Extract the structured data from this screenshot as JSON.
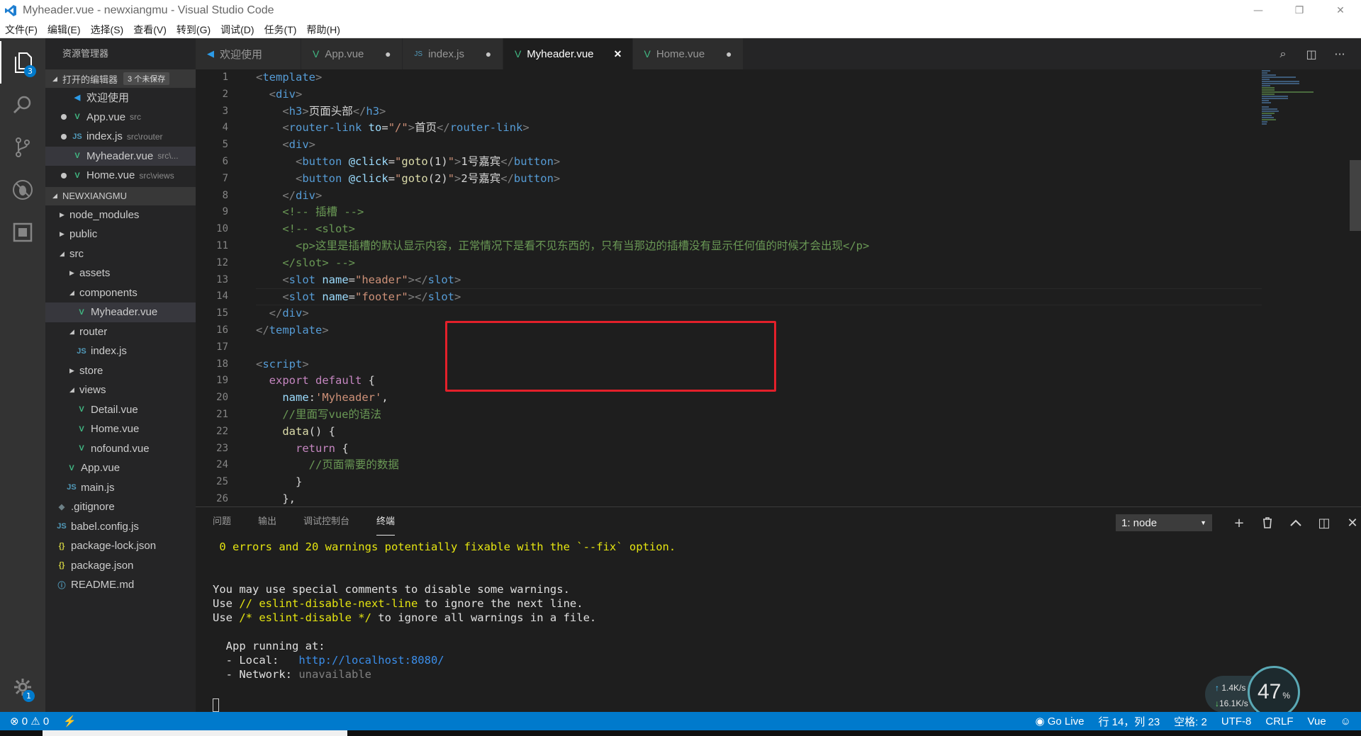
{
  "window": {
    "title": "Myheader.vue - newxiangmu - Visual Studio Code",
    "controls": {
      "minimize": "—",
      "restore": "❐",
      "close": "✕"
    }
  },
  "menu": [
    "文件(F)",
    "编辑(E)",
    "选择(S)",
    "查看(V)",
    "转到(G)",
    "调试(D)",
    "任务(T)",
    "帮助(H)"
  ],
  "activity": {
    "explorer_badge": "3",
    "settings_badge": "1"
  },
  "sidebar": {
    "header": "资源管理器",
    "open_editors": {
      "label": "打开的编辑器",
      "unsaved": "3 个未保存",
      "items": [
        {
          "name": "欢迎使用",
          "desc": "",
          "icon": "vs",
          "dirty": false
        },
        {
          "name": "App.vue",
          "desc": "src",
          "icon": "vue",
          "dirty": true
        },
        {
          "name": "index.js",
          "desc": "src\\router",
          "icon": "js",
          "dirty": true
        },
        {
          "name": "Myheader.vue",
          "desc": "src\\...",
          "icon": "vue",
          "dirty": false
        },
        {
          "name": "Home.vue",
          "desc": "src\\views",
          "icon": "vue",
          "dirty": true
        }
      ]
    },
    "project": {
      "label": "NEWXIANGMU",
      "tree": [
        {
          "name": "node_modules",
          "type": "folder",
          "open": false,
          "depth": 0
        },
        {
          "name": "public",
          "type": "folder",
          "open": false,
          "depth": 0
        },
        {
          "name": "src",
          "type": "folder",
          "open": true,
          "depth": 0
        },
        {
          "name": "assets",
          "type": "folder",
          "open": false,
          "depth": 1
        },
        {
          "name": "components",
          "type": "folder",
          "open": true,
          "depth": 1
        },
        {
          "name": "Myheader.vue",
          "type": "vue",
          "depth": 2,
          "selected": true
        },
        {
          "name": "router",
          "type": "folder",
          "open": true,
          "depth": 1
        },
        {
          "name": "index.js",
          "type": "js",
          "depth": 2
        },
        {
          "name": "store",
          "type": "folder",
          "open": false,
          "depth": 1
        },
        {
          "name": "views",
          "type": "folder",
          "open": true,
          "depth": 1
        },
        {
          "name": "Detail.vue",
          "type": "vue",
          "depth": 2
        },
        {
          "name": "Home.vue",
          "type": "vue",
          "depth": 2
        },
        {
          "name": "nofound.vue",
          "type": "vue",
          "depth": 2
        },
        {
          "name": "App.vue",
          "type": "vue",
          "depth": 1
        },
        {
          "name": "main.js",
          "type": "js",
          "depth": 1
        },
        {
          "name": ".gitignore",
          "type": "git",
          "depth": 0
        },
        {
          "name": "babel.config.js",
          "type": "js",
          "depth": 0
        },
        {
          "name": "package-lock.json",
          "type": "json",
          "depth": 0
        },
        {
          "name": "package.json",
          "type": "json",
          "depth": 0
        },
        {
          "name": "README.md",
          "type": "info",
          "depth": 0
        }
      ]
    }
  },
  "tabs": [
    {
      "label": "欢迎使用",
      "icon": "vs",
      "mark": "",
      "active": false
    },
    {
      "label": "App.vue",
      "icon": "vue",
      "mark": "●",
      "active": false
    },
    {
      "label": "index.js",
      "icon": "js",
      "mark": "●",
      "active": false
    },
    {
      "label": "Myheader.vue",
      "icon": "vue",
      "mark": "✕",
      "active": true
    },
    {
      "label": "Home.vue",
      "icon": "vue",
      "mark": "●",
      "active": false
    }
  ],
  "editor": {
    "line_numbers": [
      "1",
      "2",
      "3",
      "4",
      "5",
      "6",
      "7",
      "8",
      "9",
      "10",
      "11",
      "12",
      "13",
      "14",
      "15",
      "16",
      "17",
      "18",
      "19",
      "20",
      "21",
      "22",
      "23",
      "24",
      "25",
      "26"
    ],
    "lines": [
      [
        [
          "t-brk",
          "<"
        ],
        [
          "t-tag",
          "template"
        ],
        [
          "t-brk",
          ">"
        ]
      ],
      [
        [
          "t-txt",
          "  "
        ],
        [
          "t-brk",
          "<"
        ],
        [
          "t-tag",
          "div"
        ],
        [
          "t-brk",
          ">"
        ]
      ],
      [
        [
          "t-txt",
          "    "
        ],
        [
          "t-brk",
          "<"
        ],
        [
          "t-tag",
          "h3"
        ],
        [
          "t-brk",
          ">"
        ],
        [
          "t-txt",
          "页面头部"
        ],
        [
          "t-brk",
          "</"
        ],
        [
          "t-tag",
          "h3"
        ],
        [
          "t-brk",
          ">"
        ]
      ],
      [
        [
          "t-txt",
          "    "
        ],
        [
          "t-brk",
          "<"
        ],
        [
          "t-tag",
          "router-link"
        ],
        [
          "t-txt",
          " "
        ],
        [
          "t-attr",
          "to"
        ],
        [
          "t-txt",
          "="
        ],
        [
          "t-str",
          "\"/\""
        ],
        [
          "t-brk",
          ">"
        ],
        [
          "t-txt",
          "首页"
        ],
        [
          "t-brk",
          "</"
        ],
        [
          "t-tag",
          "router-link"
        ],
        [
          "t-brk",
          ">"
        ]
      ],
      [
        [
          "t-txt",
          "    "
        ],
        [
          "t-brk",
          "<"
        ],
        [
          "t-tag",
          "div"
        ],
        [
          "t-brk",
          ">"
        ]
      ],
      [
        [
          "t-txt",
          "      "
        ],
        [
          "t-brk",
          "<"
        ],
        [
          "t-tag",
          "button"
        ],
        [
          "t-txt",
          " "
        ],
        [
          "t-attr",
          "@click"
        ],
        [
          "t-txt",
          "="
        ],
        [
          "t-str",
          "\""
        ],
        [
          "t-fn",
          "goto"
        ],
        [
          "t-txt",
          "(1)"
        ],
        [
          "t-str",
          "\""
        ],
        [
          "t-brk",
          ">"
        ],
        [
          "t-txt",
          "1号嘉宾"
        ],
        [
          "t-brk",
          "</"
        ],
        [
          "t-tag",
          "button"
        ],
        [
          "t-brk",
          ">"
        ]
      ],
      [
        [
          "t-txt",
          "      "
        ],
        [
          "t-brk",
          "<"
        ],
        [
          "t-tag",
          "button"
        ],
        [
          "t-txt",
          " "
        ],
        [
          "t-attr",
          "@click"
        ],
        [
          "t-txt",
          "="
        ],
        [
          "t-str",
          "\""
        ],
        [
          "t-fn",
          "goto"
        ],
        [
          "t-txt",
          "(2)"
        ],
        [
          "t-str",
          "\""
        ],
        [
          "t-brk",
          ">"
        ],
        [
          "t-txt",
          "2号嘉宾"
        ],
        [
          "t-brk",
          "</"
        ],
        [
          "t-tag",
          "button"
        ],
        [
          "t-brk",
          ">"
        ]
      ],
      [
        [
          "t-txt",
          "    "
        ],
        [
          "t-brk",
          "</"
        ],
        [
          "t-tag",
          "div"
        ],
        [
          "t-brk",
          ">"
        ]
      ],
      [
        [
          "t-txt",
          "    "
        ],
        [
          "t-cmt",
          "<!-- 插槽 -->"
        ]
      ],
      [
        [
          "t-txt",
          "    "
        ],
        [
          "t-cmt",
          "<!-- <slot>"
        ]
      ],
      [
        [
          "t-txt",
          "      "
        ],
        [
          "t-cmt",
          "<p>这里是插槽的默认显示内容，正常情况下是看不见东西的，只有当那边的插槽没有显示任何值的时候才会出现</p>"
        ]
      ],
      [
        [
          "t-txt",
          "    "
        ],
        [
          "t-cmt",
          "</slot> -->"
        ]
      ],
      [
        [
          "t-txt",
          "    "
        ],
        [
          "t-brk",
          "<"
        ],
        [
          "t-tag",
          "slot"
        ],
        [
          "t-txt",
          " "
        ],
        [
          "t-attr",
          "name"
        ],
        [
          "t-txt",
          "="
        ],
        [
          "t-str",
          "\"header\""
        ],
        [
          "t-brk",
          "></"
        ],
        [
          "t-tag",
          "slot"
        ],
        [
          "t-brk",
          ">"
        ]
      ],
      [
        [
          "t-txt",
          "    "
        ],
        [
          "t-brk",
          "<"
        ],
        [
          "t-tag",
          "slot"
        ],
        [
          "t-txt",
          " "
        ],
        [
          "t-attr",
          "name"
        ],
        [
          "t-txt",
          "="
        ],
        [
          "t-str",
          "\"footer\""
        ],
        [
          "t-brk",
          "></"
        ],
        [
          "t-tag",
          "slot"
        ],
        [
          "t-brk",
          ">"
        ]
      ],
      [
        [
          "t-txt",
          "  "
        ],
        [
          "t-brk",
          "</"
        ],
        [
          "t-tag",
          "div"
        ],
        [
          "t-brk",
          ">"
        ]
      ],
      [
        [
          "t-brk",
          "</"
        ],
        [
          "t-tag",
          "template"
        ],
        [
          "t-brk",
          ">"
        ]
      ],
      [
        [
          "t-txt",
          ""
        ]
      ],
      [
        [
          "t-brk",
          "<"
        ],
        [
          "t-tag",
          "script"
        ],
        [
          "t-brk",
          ">"
        ]
      ],
      [
        [
          "t-txt",
          "  "
        ],
        [
          "t-kw",
          "export"
        ],
        [
          "t-txt",
          " "
        ],
        [
          "t-kw",
          "default"
        ],
        [
          "t-txt",
          " {"
        ]
      ],
      [
        [
          "t-txt",
          "    "
        ],
        [
          "t-key",
          "name"
        ],
        [
          "t-txt",
          ":"
        ],
        [
          "t-str",
          "'Myheader'"
        ],
        [
          "t-txt",
          ","
        ]
      ],
      [
        [
          "t-txt",
          "    "
        ],
        [
          "t-cmt",
          "//里面写vue的语法"
        ]
      ],
      [
        [
          "t-txt",
          "    "
        ],
        [
          "t-fn",
          "data"
        ],
        [
          "t-txt",
          "() {"
        ]
      ],
      [
        [
          "t-txt",
          "      "
        ],
        [
          "t-kw",
          "return"
        ],
        [
          "t-txt",
          " {"
        ]
      ],
      [
        [
          "t-txt",
          "        "
        ],
        [
          "t-cmt",
          "//页面需要的数据"
        ]
      ],
      [
        [
          "t-txt",
          "      }"
        ]
      ],
      [
        [
          "t-txt",
          "    },"
        ]
      ]
    ],
    "current_line_index": 13
  },
  "panel": {
    "tabs": [
      "问题",
      "输出",
      "调试控制台",
      "终端"
    ],
    "active_tab": "终端",
    "terminal_select": "1: node",
    "actions": {
      "add": "+",
      "trash": "🗑",
      "maximize": "︿",
      "split": "◫",
      "close": "✕"
    },
    "terminal_lines": [
      [
        [
          "term-yellow",
          " 0 errors and 20 warnings potentially fixable with the `--fix` option."
        ]
      ],
      [
        [
          "",
          ""
        ]
      ],
      [
        [
          "",
          ""
        ]
      ],
      [
        [
          "",
          "You may use special comments to disable some warnings."
        ]
      ],
      [
        [
          "",
          "Use "
        ],
        [
          "term-yellow",
          "// eslint-disable-next-line"
        ],
        [
          "",
          " to ignore the next line."
        ]
      ],
      [
        [
          "",
          "Use "
        ],
        [
          "term-yellow",
          "/* eslint-disable */"
        ],
        [
          "",
          " to ignore all warnings in a file."
        ]
      ],
      [
        [
          "",
          ""
        ]
      ],
      [
        [
          "",
          "  App running at:"
        ]
      ],
      [
        [
          "",
          "  - Local:   "
        ],
        [
          "term-cyan",
          "http://localhost:8080/"
        ]
      ],
      [
        [
          "",
          "  - Network: "
        ],
        [
          "term-grey",
          "unavailable"
        ]
      ]
    ]
  },
  "netwidget": {
    "up": "1.4K/s",
    "down": "16.1K/s",
    "percent": "47",
    "percent_unit": "%"
  },
  "statusbar": {
    "errors": "0",
    "warnings": "0",
    "go_live": "Go Live",
    "position": "行 14，列 23",
    "indent": "空格: 2",
    "encoding": "UTF-8",
    "eol": "CRLF",
    "language": "Vue"
  },
  "colors": {
    "accent": "#007acc",
    "highlight": "#e3202a",
    "vue": "#41b883"
  }
}
